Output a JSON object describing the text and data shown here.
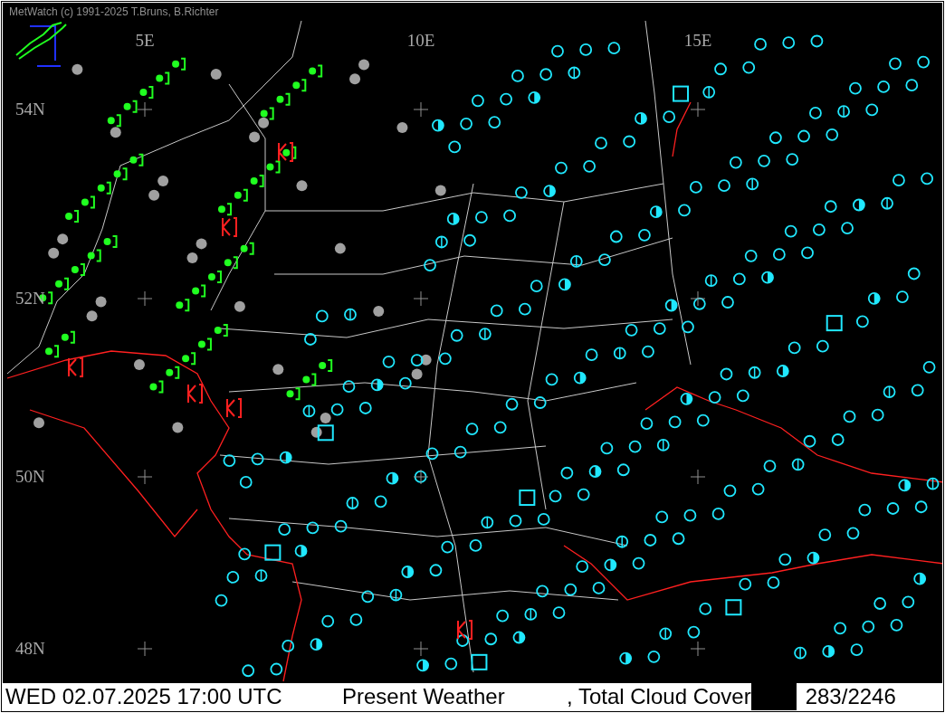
{
  "header": {
    "copyright": "MetWatch  (c) 1991-2025 T.Bruns, B.Richter"
  },
  "map": {
    "longitude_labels": [
      "5E",
      "10E",
      "15E"
    ],
    "latitude_labels": [
      "54N",
      "52N",
      "50N",
      "48N"
    ]
  },
  "status_bar": {
    "time": "WED 02.07.2025 17:00 UTC",
    "parameter_1": "Present Weather",
    "parameter_2": ", Total Cloud Cover",
    "count": "283/2246"
  }
}
